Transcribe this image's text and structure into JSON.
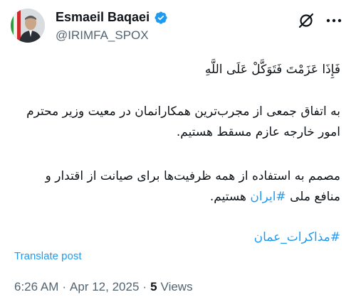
{
  "author": {
    "display_name": "Esmaeil Baqaei",
    "handle": "@IRIMFA_SPOX",
    "verified": true
  },
  "icons": {
    "grok": "grok-icon",
    "more": "more-options-icon",
    "verified": "verified-badge-icon"
  },
  "post": {
    "line1": "فَإِذَا عَزَمْتَ فَتَوَكَّلْ عَلَى اللَّهِ",
    "para1_line1": "به اتفاق جمعی از مجرب‌ترین همکارانمان در معیت وزیر محترم",
    "para1_line2": "امور خارجه عازم مسقط هستیم.",
    "para2_line1": "مصمم به استفاده از همه ظرفیت‌ها برای صیانت از اقتدار و",
    "para2_line2_prefix": "منافع ملی ",
    "para2_line2_link": "#ایران",
    "para2_line2_suffix": " هستیم.",
    "hashtag": "#مذاکرات_عمان"
  },
  "translate_label": "Translate post",
  "meta": {
    "time": "6:26 AM",
    "separator1": "·",
    "date": "Apr 12, 2025",
    "separator2": "·",
    "views_count": "5",
    "views_label": "Views"
  },
  "colors": {
    "accent": "#1d9bf0",
    "text": "#0f1419",
    "secondary": "#536471"
  }
}
